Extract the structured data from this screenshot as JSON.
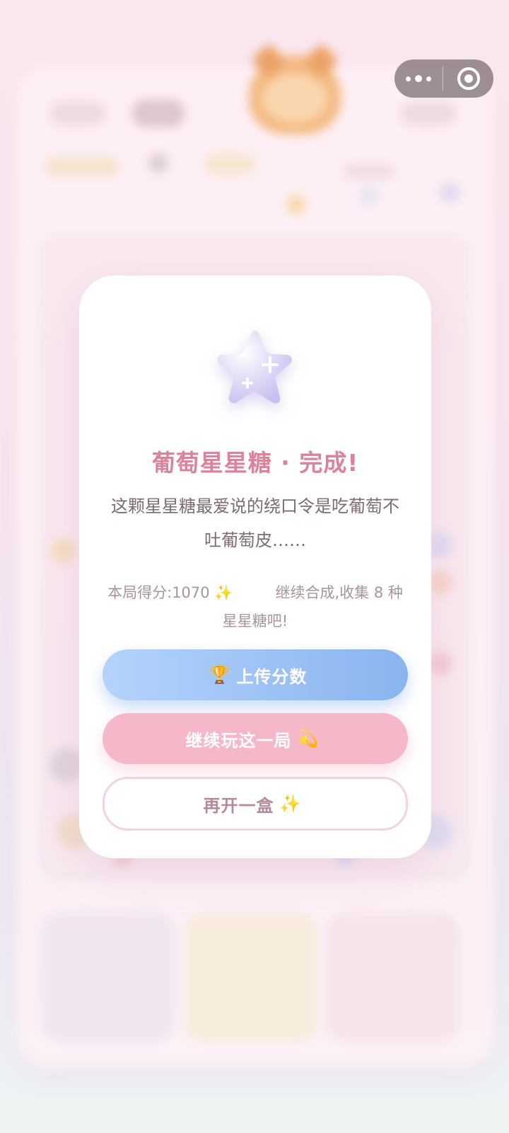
{
  "modal": {
    "title": "葡萄星星糖 · 完成!",
    "description": "这颗星星糖最爱说的绕口令是吃葡萄不吐葡萄皮……",
    "score_text": "本局得分:1070 ✨",
    "hint_text": "继续合成,收集 8 种星星糖吧!",
    "buttons": {
      "upload": {
        "icon": "🏆",
        "label": "上传分数"
      },
      "continue": {
        "label": "继续玩这一局",
        "icon": "💫"
      },
      "restart": {
        "label": "再开一盒",
        "icon": "✨"
      }
    }
  },
  "capsule": {
    "more_icon": "more-dots-icon",
    "close_icon": "target-close-icon"
  },
  "colors": {
    "accent_pink": "#d9839c",
    "upload_blue": "#8ab4ef",
    "continue_pink": "#f5b8c9",
    "star_purple": "#d8d0f4"
  }
}
